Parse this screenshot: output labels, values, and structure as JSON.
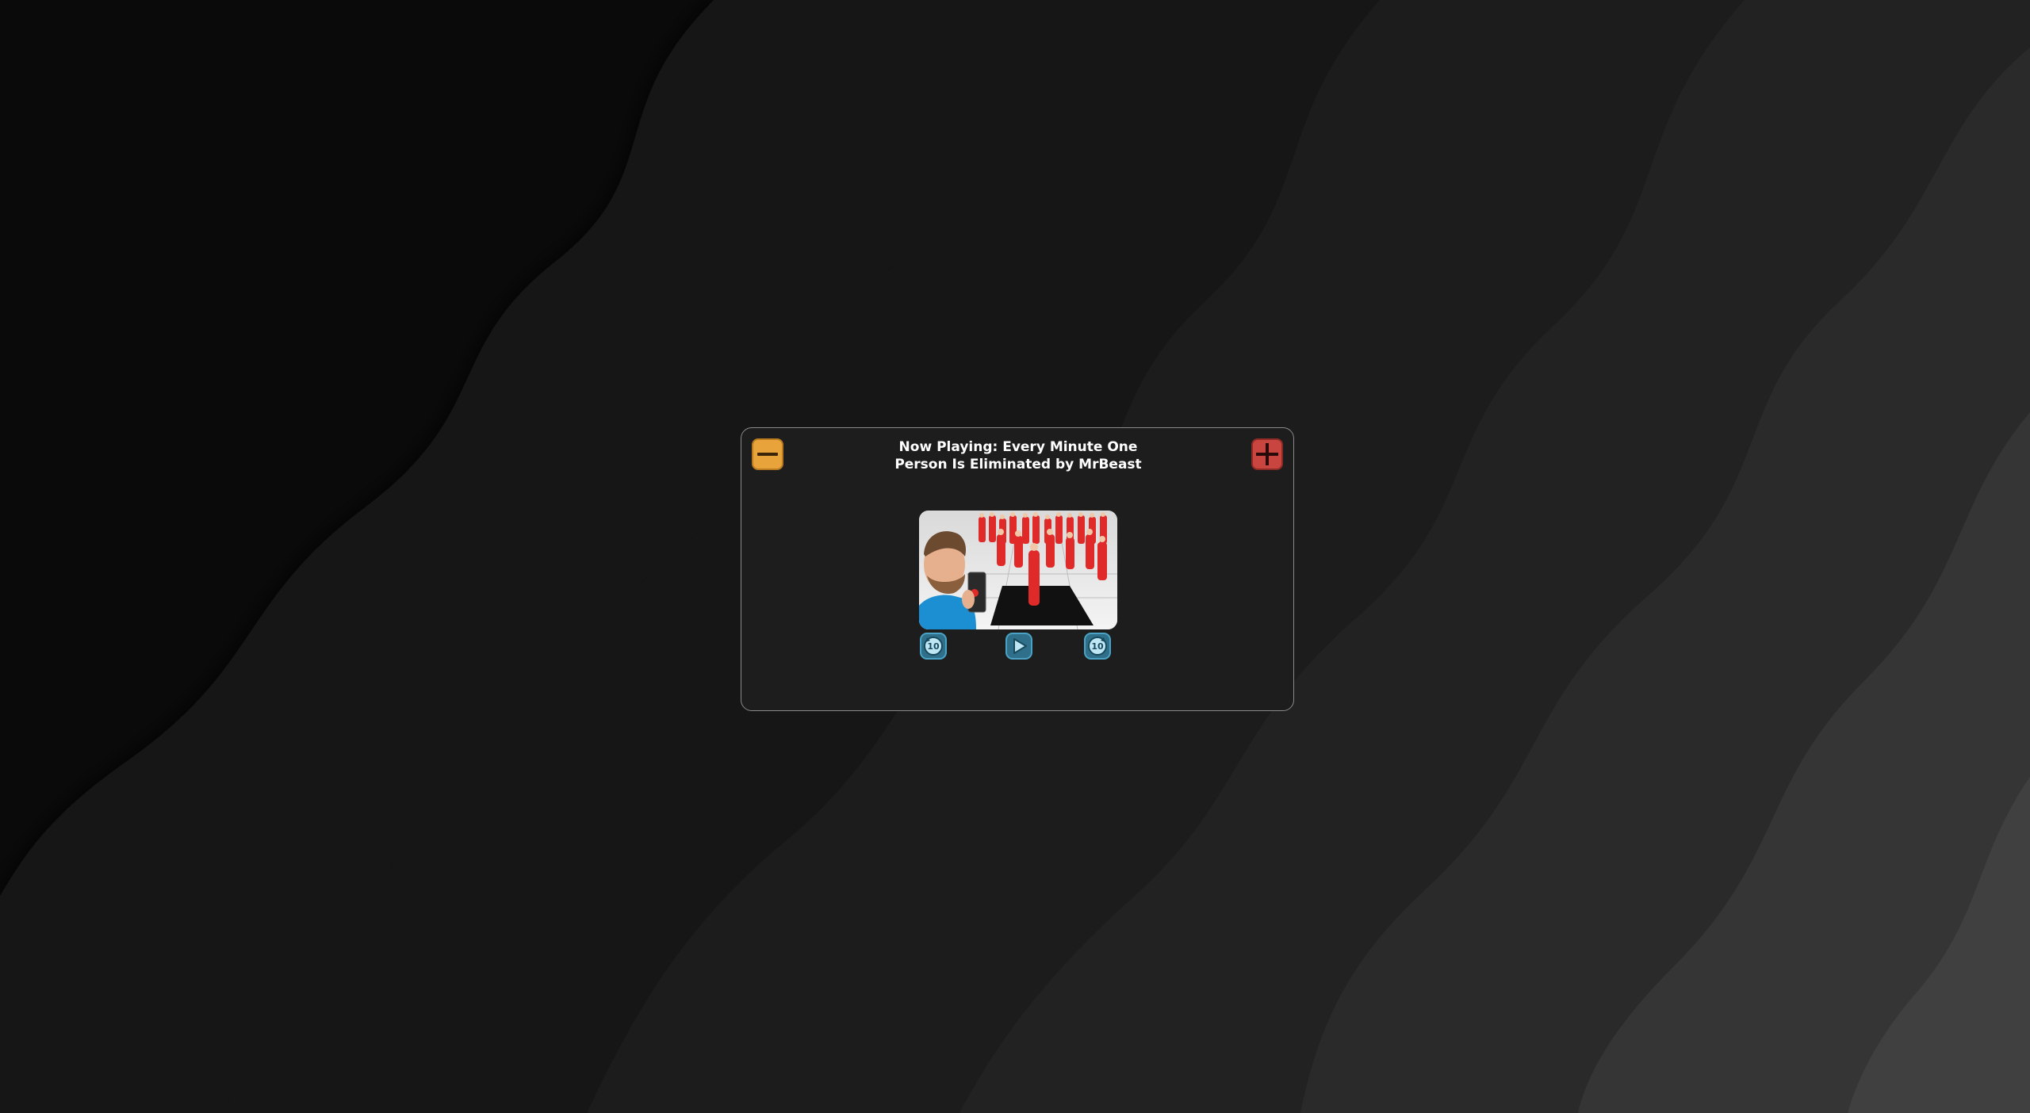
{
  "window": {
    "title": "Now Playing: Every Minute One Person Is Eliminated by MrBeast"
  },
  "titlebar": {
    "minimize_icon": "minus-icon",
    "close_icon": "plus-icon"
  },
  "video": {
    "thumbnail_alt": "Every Minute One Person Is Eliminated thumbnail"
  },
  "controls": {
    "rewind": {
      "icon": "rewind-10-icon",
      "label": "10"
    },
    "play": {
      "icon": "play-icon"
    },
    "forward": {
      "icon": "forward-10-icon",
      "label": "10"
    }
  },
  "colors": {
    "minimize": "#e8a33a",
    "close": "#c9453f",
    "control_accent": "#4aa3c7",
    "window_bg": "#1d1d1d"
  }
}
